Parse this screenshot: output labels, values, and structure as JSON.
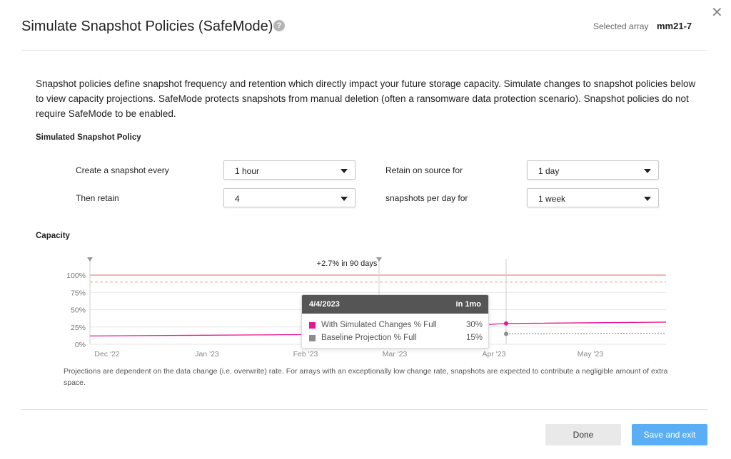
{
  "header": {
    "title": "Simulate Snapshot Policies (SafeMode)",
    "help_icon": "question-circle-icon",
    "close_icon": "close-icon",
    "selected_array_label": "Selected array",
    "selected_array_value": "mm21-7"
  },
  "description": "Snapshot policies define snapshot frequency and retention which directly impact your future storage capacity. Simulate changes to snapshot policies below to view capacity projections. SafeMode protects snapshots from manual deletion (often a ransomware data protection scenario). Snapshot policies do not require SafeMode to be enabled.",
  "policy": {
    "section_title": "Simulated Snapshot Policy",
    "create_label": "Create a snapshot every",
    "create_value": "1 hour",
    "retain_source_label": "Retain on source for",
    "retain_source_value": "1 day",
    "then_retain_label": "Then retain",
    "then_retain_value": "4",
    "per_day_label": "snapshots per day for",
    "per_day_value": "1 week"
  },
  "capacity": {
    "section_title": "Capacity",
    "annotation": "+2.7% in 90 days",
    "footnote": "Projections are dependent on the data change (i.e. overwrite) rate. For arrays with an exceptionally low change rate, snapshots are expected to contribute a negligible amount of extra space."
  },
  "chart_data": {
    "type": "line",
    "y_ticks": [
      "100%",
      "75%",
      "50%",
      "25%",
      "0%"
    ],
    "x_ticks": [
      "Dec '22",
      "Jan '23",
      "Feb '23",
      "Mar '23",
      "Apr '23",
      "May '23"
    ],
    "ylim": [
      0,
      100
    ],
    "grid": true,
    "colors": {
      "simulated": "#e8158f",
      "baseline": "#8c8c8c",
      "limit": "#e8524a"
    },
    "limit_lines": [
      {
        "value": 100,
        "style": "solid"
      },
      {
        "value": 90,
        "style": "dashed"
      }
    ],
    "series": [
      {
        "name": "With Simulated Changes % Full",
        "x": [
          "Dec '22",
          "Feb '23",
          "4/4/2023",
          "May '23"
        ],
        "values": [
          12,
          14,
          30,
          32
        ]
      },
      {
        "name": "Baseline Projection % Full",
        "x": [
          "4/4/2023",
          "May '23"
        ],
        "values": [
          15,
          16
        ]
      }
    ]
  },
  "tooltip": {
    "date": "4/4/2023",
    "range": "in 1mo",
    "rows": [
      {
        "label": "With Simulated Changes % Full",
        "value": "30%",
        "color": "#e8158f"
      },
      {
        "label": "Baseline Projection % Full",
        "value": "15%",
        "color": "#8c8c8c"
      }
    ]
  },
  "footer": {
    "done_label": "Done",
    "save_label": "Save and exit"
  }
}
